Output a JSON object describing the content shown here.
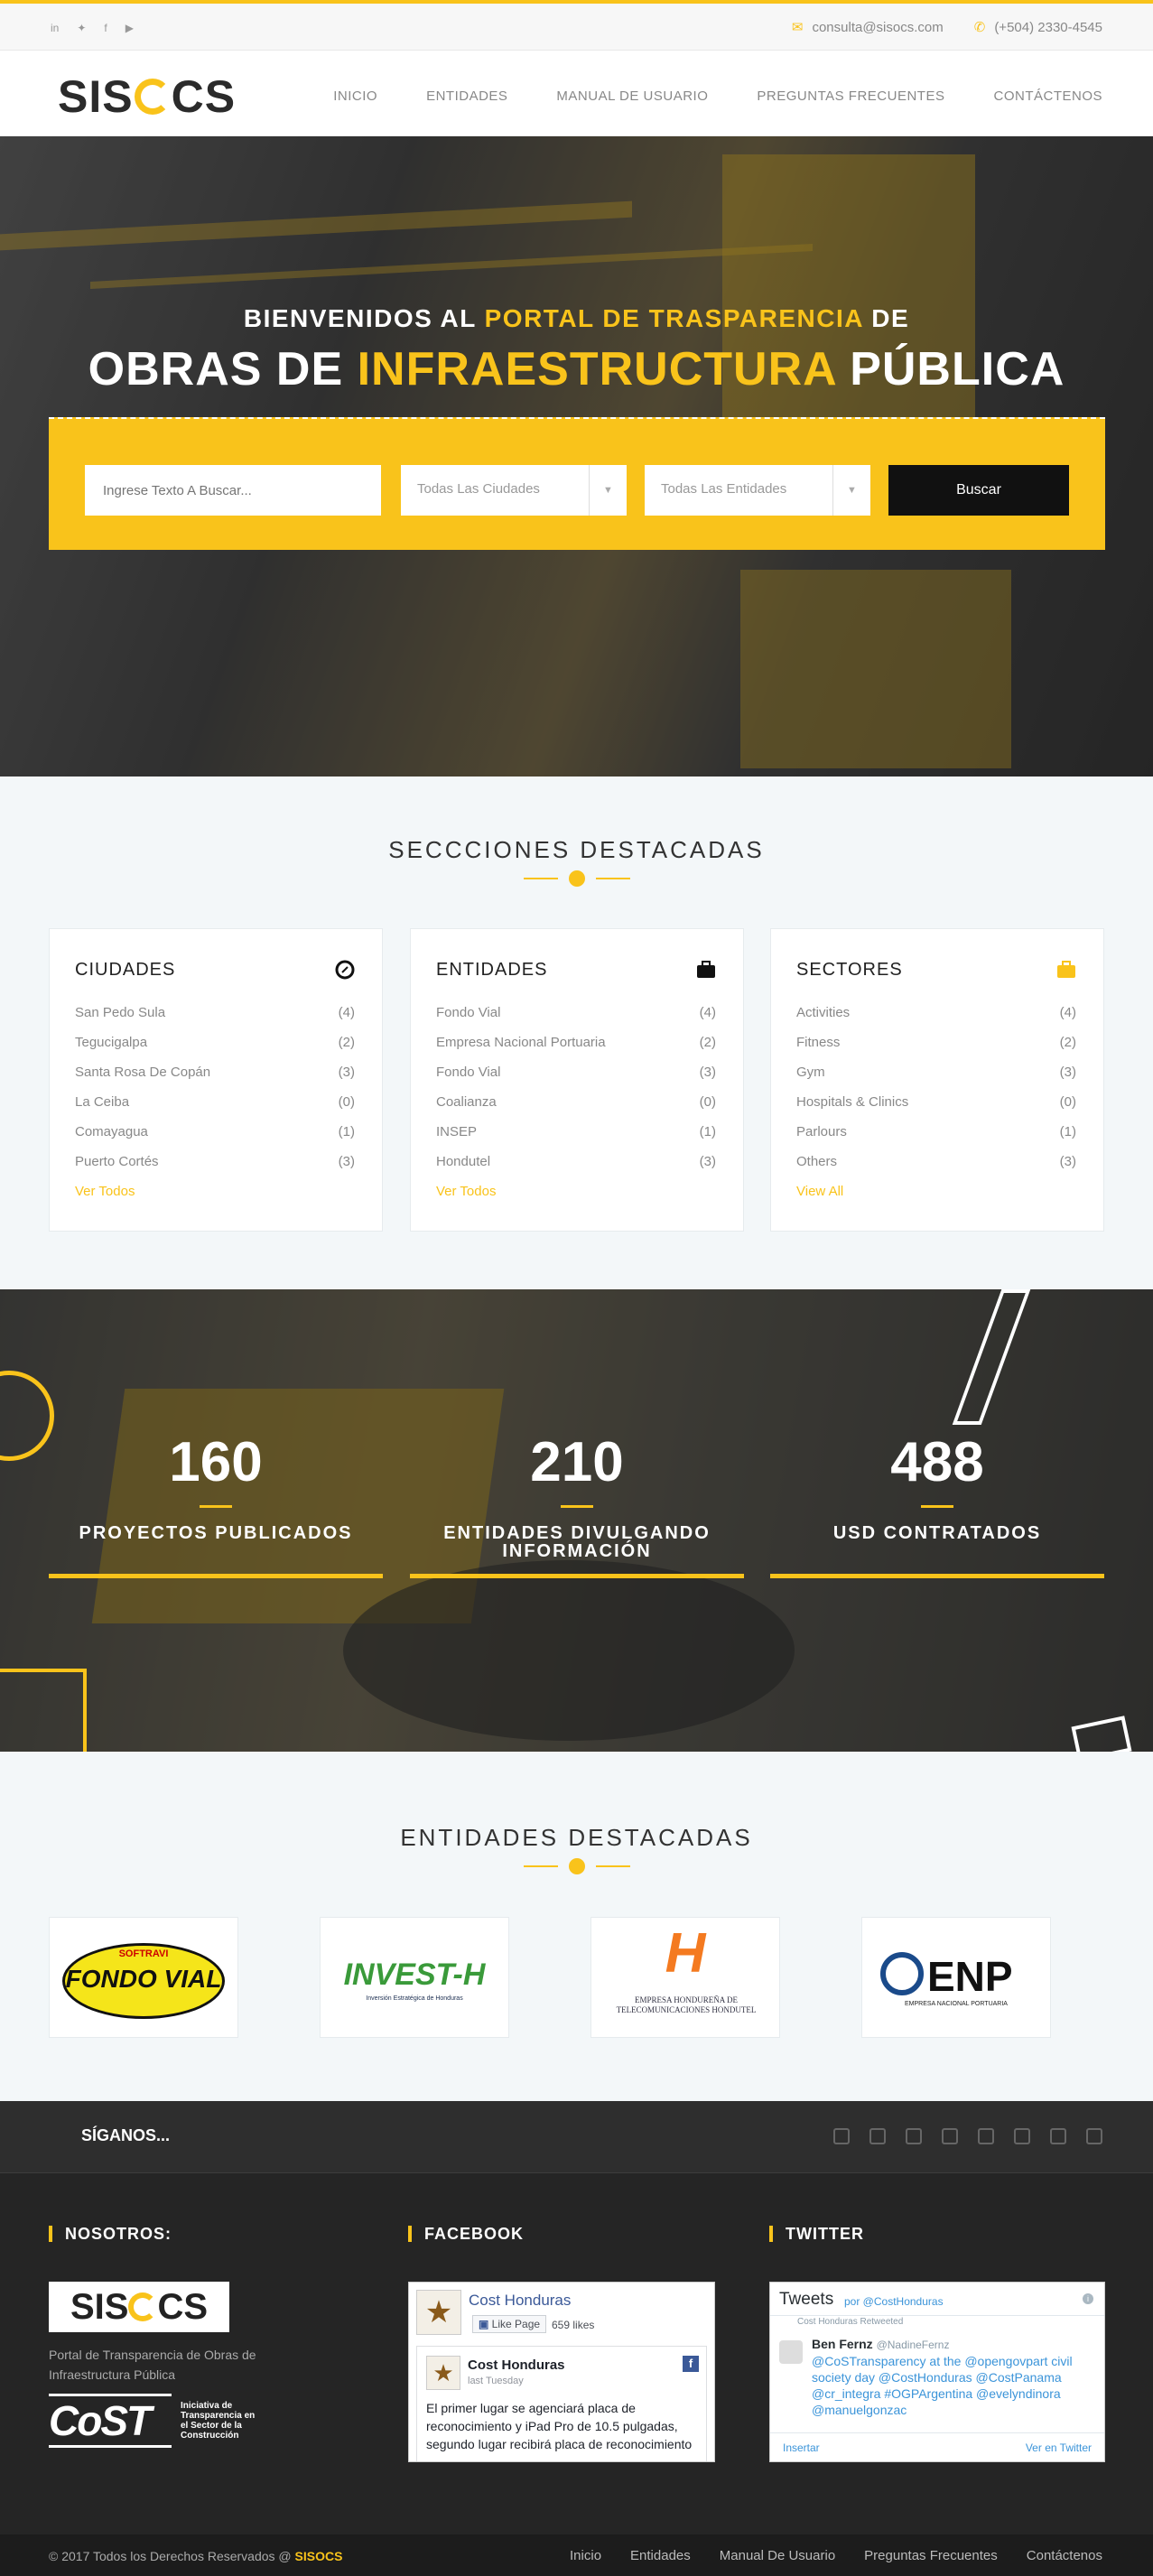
{
  "topbar": {
    "email": "consulta@sisocs.com",
    "phone": "(+504) 2330-4545",
    "socials": [
      "linkedin-icon",
      "twitter-icon",
      "facebook-icon",
      "youtube-icon"
    ]
  },
  "brand": {
    "logo_left": "SIS",
    "logo_right": "CS"
  },
  "nav": [
    "INICIO",
    "ENTIDADES",
    "MANUAL DE USUARIO",
    "PREGUNTAS FRECUENTES",
    "CONTÁCTENOS"
  ],
  "hero": {
    "sub_a": "BIENVENIDOS AL ",
    "sub_b": "PORTAL DE TRASPARENCIA",
    "sub_c": " DE",
    "title_a": "OBRAS DE ",
    "title_b": "INFRAESTRUCTURA",
    "title_c": " PÚBLICA",
    "search_placeholder": "Ingrese Texto A Buscar...",
    "city_select": "Todas Las Ciudades",
    "entity_select": "Todas Las Entidades",
    "search_button": "Buscar"
  },
  "featured": {
    "title": "SECCCIONES DESTACADAS",
    "cards": [
      {
        "title": "CIUDADES",
        "more": "Ver Todos",
        "items": [
          [
            "San Pedo Sula",
            "(4)"
          ],
          [
            "Tegucigalpa",
            "(2)"
          ],
          [
            "Santa Rosa De Copán",
            "(3)"
          ],
          [
            "La Ceiba",
            "(0)"
          ],
          [
            "Comayagua",
            "(1)"
          ],
          [
            "Puerto Cortés",
            "(3)"
          ]
        ]
      },
      {
        "title": "ENTIDADES",
        "more": "Ver Todos",
        "items": [
          [
            "Fondo Vial",
            "(4)"
          ],
          [
            "Empresa Nacional Portuaria",
            "(2)"
          ],
          [
            "Fondo Vial",
            "(3)"
          ],
          [
            "Coalianza",
            "(0)"
          ],
          [
            "INSEP",
            "(1)"
          ],
          [
            "Hondutel",
            "(3)"
          ]
        ]
      },
      {
        "title": "SECTORES",
        "more": "View All",
        "items": [
          [
            "Activities",
            "(4)"
          ],
          [
            "Fitness",
            "(2)"
          ],
          [
            "Gym",
            "(3)"
          ],
          [
            "Hospitals & Clinics",
            "(0)"
          ],
          [
            "Parlours",
            "(1)"
          ],
          [
            "Others",
            "(3)"
          ]
        ]
      }
    ]
  },
  "stats": [
    {
      "num": "160",
      "label": "PROYECTOS PUBLICADOS"
    },
    {
      "num": "210",
      "label": "ENTIDADES DIVULGANDO INFORMACIÓN"
    },
    {
      "num": "488",
      "label": "USD CONTRATADOS"
    }
  ],
  "entities": {
    "title": "ENTIDADES DESTACADAS",
    "logos": [
      {
        "top": "SOFTRAVI",
        "main": "FONDO VIAL"
      },
      {
        "main": "INVEST-H",
        "sub": "Inversión Estratégica de Honduras"
      },
      {
        "main": "H",
        "sub": "EMPRESA HONDUREÑA DE TELECOMUNICACIONES HONDUTEL"
      },
      {
        "main": "ENP",
        "sub": "EMPRESA NACIONAL PORTUARIA"
      }
    ]
  },
  "footer": {
    "follow": "SÍGANOS...",
    "nosotros": "NOSOTROS:",
    "facebook": "FACEBOOK",
    "twitter": "TWITTER",
    "desc": "Portal de Transparencia de Obras de Infraestructura Pública",
    "cost_mark": "CoST",
    "cost_text": "Iniciativa de Transparencia en el Sector de la Construcción",
    "fb": {
      "page": "Cost Honduras",
      "like": "Like Page",
      "likes": "659 likes",
      "post_author": "Cost Honduras",
      "post_time": "last Tuesday",
      "post_text": "El primer lugar se agenciará placa de reconocimiento y iPad Pro de 10.5 pulgadas, segundo lugar recibirá placa de reconocimiento"
    },
    "tw": {
      "head": "Tweets",
      "by": "por @CostHonduras",
      "retweet": "Cost Honduras Retweeted",
      "name": "Ben Fernz",
      "handle": "@NadineFernz",
      "text": "@CoSTransparency at the @opengovpart civil society day @CostHonduras @CostPanama @cr_integra #OGPArgentina @evelyndinora @manuelgonzac",
      "embed": "Insertar",
      "view": "Ver en Twitter"
    },
    "copy_a": "© 2017 Todos los Derechos Reservados @ ",
    "copy_b": "SISOCS",
    "links": [
      "Inicio",
      "Entidades",
      "Manual De Usuario",
      "Preguntas Frecuentes",
      "Contáctenos"
    ]
  },
  "colors": {
    "accent": "#f9c31b",
    "dark": "#252525"
  }
}
